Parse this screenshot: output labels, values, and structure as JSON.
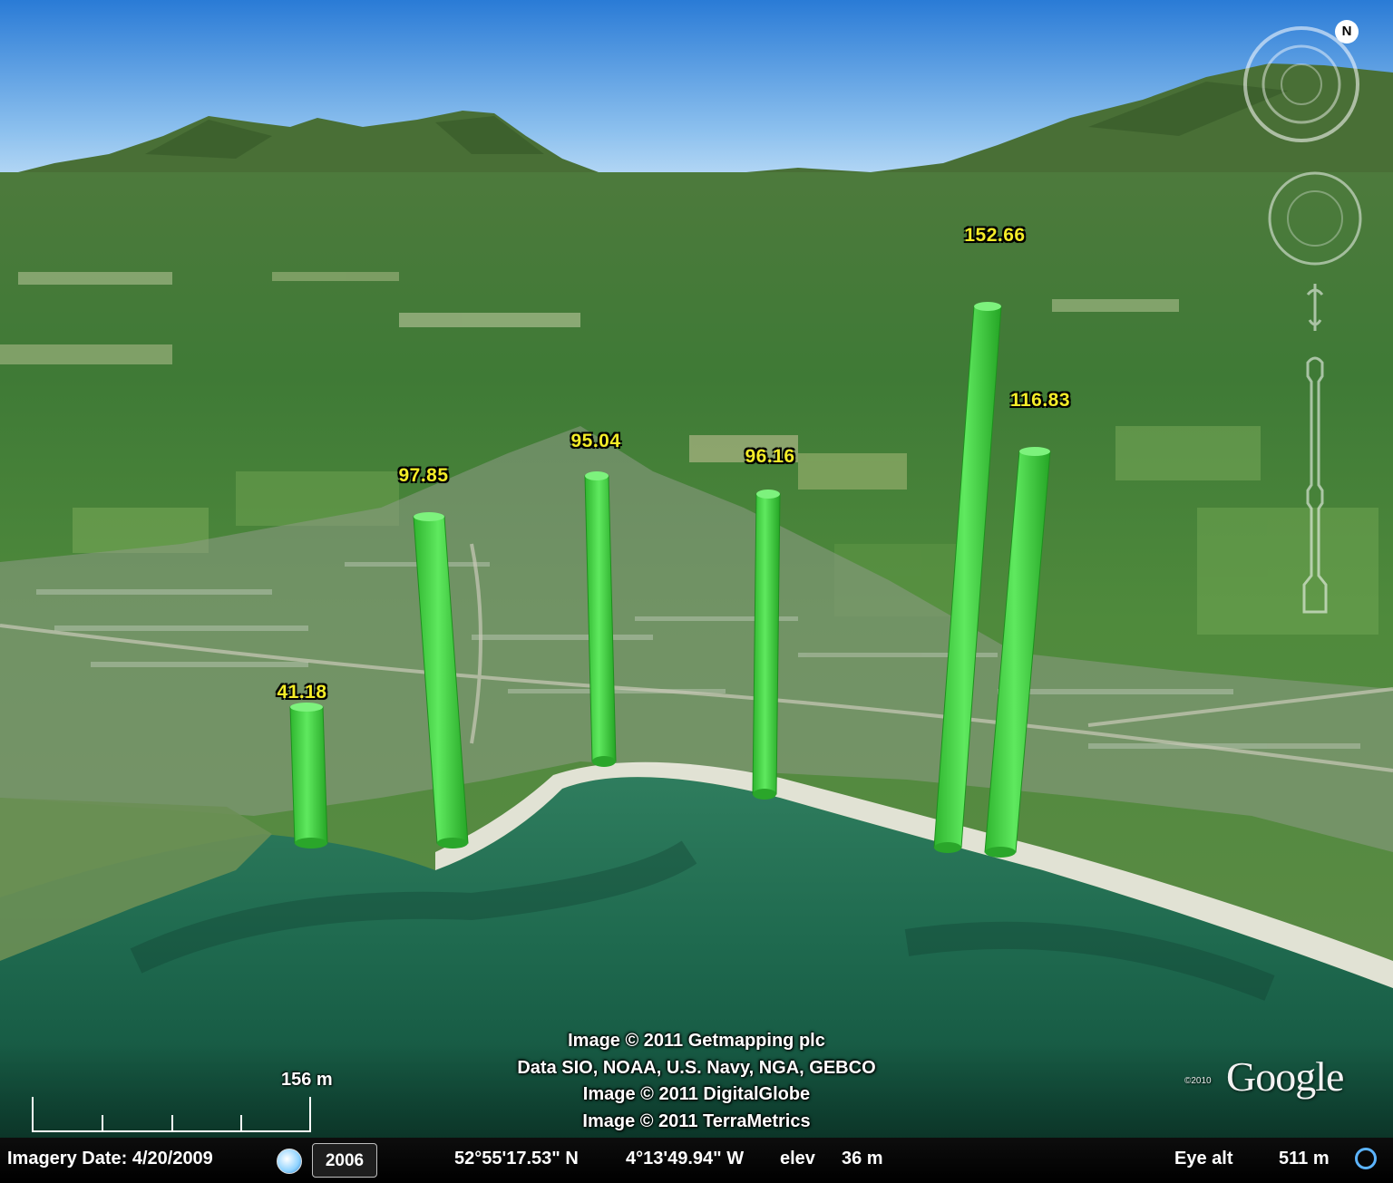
{
  "bars": [
    {
      "id": "bar-1",
      "value": "41.18"
    },
    {
      "id": "bar-2",
      "value": "97.85"
    },
    {
      "id": "bar-3",
      "value": "95.04"
    },
    {
      "id": "bar-4",
      "value": "96.16"
    },
    {
      "id": "bar-5",
      "value": "152.66"
    },
    {
      "id": "bar-6",
      "value": "116.83"
    }
  ],
  "attribution": {
    "line1": "Image © 2011 Getmapping plc",
    "line2": "Data SIO, NOAA, U.S. Navy, NGA, GEBCO",
    "line3": "Image © 2011 DigitalGlobe",
    "line4": "Image © 2011 TerraMetrics"
  },
  "logo": {
    "text": "Google",
    "copyright": "©2010"
  },
  "scale": {
    "label": "156 m"
  },
  "compass": {
    "north_label": "N"
  },
  "status": {
    "imagery_date": "Imagery Date: 4/20/2009",
    "year": "2006",
    "latitude": "52°55'17.53\" N",
    "longitude": "4°13'49.94\" W",
    "elev_label": "elev",
    "elev_value": "36 m",
    "eye_alt_label": "Eye alt",
    "eye_alt_value": "511 m"
  }
}
